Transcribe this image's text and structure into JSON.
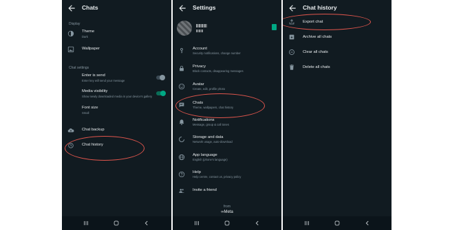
{
  "screens": {
    "chats": {
      "title": "Chats",
      "display_section": "Display",
      "theme": {
        "label": "Theme",
        "value": "Dark"
      },
      "wallpaper": {
        "label": "Wallpaper"
      },
      "chat_settings_section": "Chat settings",
      "enter_is_send": {
        "label": "Enter is send",
        "desc": "Enter key will send your message",
        "enabled": false
      },
      "media_visibility": {
        "label": "Media visibility",
        "desc": "Show newly downloaded media in your device's gallery",
        "enabled": true
      },
      "font_size": {
        "label": "Font size",
        "value": "Small"
      },
      "chat_backup": {
        "label": "Chat backup"
      },
      "chat_history": {
        "label": "Chat history"
      }
    },
    "settings": {
      "title": "Settings",
      "items": [
        {
          "label": "Account",
          "desc": "Security notifications, change number",
          "icon": "key-icon"
        },
        {
          "label": "Privacy",
          "desc": "Block contacts, disappearing messages",
          "icon": "lock-icon"
        },
        {
          "label": "Avatar",
          "desc": "Create, edit, profile photo",
          "icon": "avatar-icon"
        },
        {
          "label": "Chats",
          "desc": "Theme, wallpapers, chat history",
          "icon": "chat-icon"
        },
        {
          "label": "Notifications",
          "desc": "Message, group & call tones",
          "icon": "bell-icon"
        },
        {
          "label": "Storage and data",
          "desc": "Network usage, auto-download",
          "icon": "storage-icon"
        },
        {
          "label": "App language",
          "desc": "English (phone's language)",
          "icon": "globe-icon"
        },
        {
          "label": "Help",
          "desc": "Help centre, contact us, privacy policy",
          "icon": "help-icon"
        },
        {
          "label": "Invite a friend",
          "desc": "",
          "icon": "people-icon"
        }
      ],
      "footer_from": "from",
      "footer_brand": "Meta"
    },
    "chat_history": {
      "title": "Chat history",
      "items": [
        {
          "label": "Export chat",
          "icon": "export-icon"
        },
        {
          "label": "Archive all chats",
          "icon": "archive-icon"
        },
        {
          "label": "Clear all chats",
          "icon": "clear-icon"
        },
        {
          "label": "Delete all chats",
          "icon": "delete-icon"
        }
      ]
    }
  },
  "colors": {
    "background": "#111b21",
    "text_primary": "#e9edef",
    "text_secondary": "#8696a0",
    "accent": "#00a884",
    "highlight_circle": "#e2564d",
    "navbar": "#0b141a"
  }
}
